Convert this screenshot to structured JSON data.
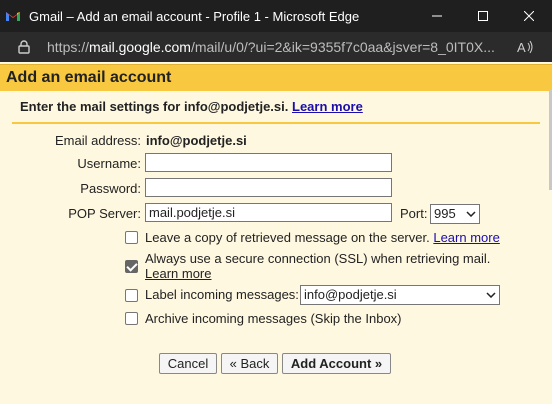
{
  "window": {
    "title": "Gmail – Add an email account - Profile 1 - Microsoft Edge",
    "controls": [
      "minimize",
      "maximize",
      "close"
    ]
  },
  "address_bar": {
    "prefix": "https://",
    "host": "mail.google.com",
    "path": "/mail/u/0/?ui=2&ik=9355f7c0aa&jsver=8_0IT0X..."
  },
  "page": {
    "heading": "Add an email account",
    "instructions": "Enter the mail settings for info@podjetje.si.",
    "instructions_link": "Learn more"
  },
  "form": {
    "email_label": "Email address:",
    "email_value": "info@podjetje.si",
    "username_label": "Username:",
    "username_value": "",
    "password_label": "Password:",
    "password_value": "",
    "pop_label": "POP Server:",
    "pop_value": "mail.podjetje.si",
    "port_label": "Port:",
    "port_value": "995",
    "options": {
      "leave_copy": {
        "text": "Leave a copy of retrieved message on the server.",
        "link": "Learn more",
        "checked": false
      },
      "ssl": {
        "text": "Always use a secure connection (SSL) when retrieving mail.",
        "link": "Learn more",
        "checked": true
      },
      "label_incoming": {
        "text": "Label incoming messages:",
        "select_value": "info@podjetje.si",
        "checked": false
      },
      "archive": {
        "text": "Archive incoming messages (Skip the Inbox)",
        "checked": false
      }
    }
  },
  "buttons": {
    "cancel": "Cancel",
    "back": "« Back",
    "add_account": "Add Account »"
  },
  "colors": {
    "header_bg": "#f7c840",
    "page_bg": "#fff8e1",
    "link": "#1a0dab",
    "titlebar_bg": "#1f1f1f"
  }
}
